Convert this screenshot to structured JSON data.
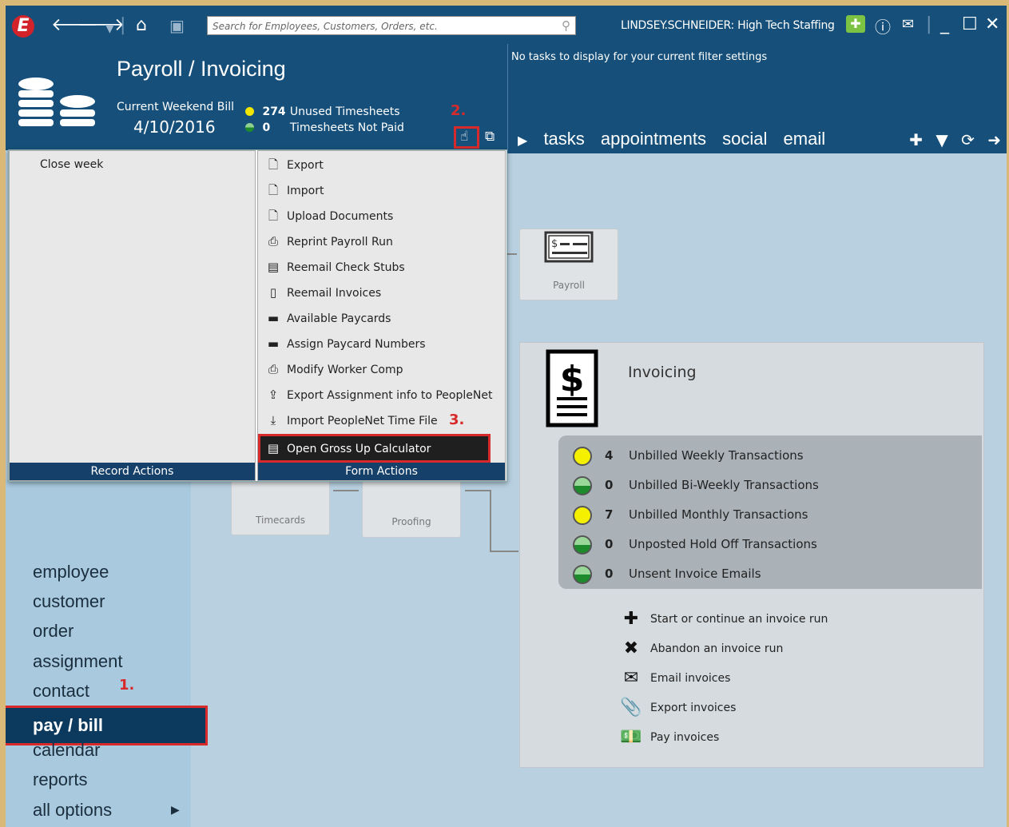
{
  "titlebar": {
    "logo_letter": "E",
    "search_placeholder": "Search for Employees, Customers, Orders, etc.",
    "user_label": "LINDSEY.SCHNEIDER: High Tech Staffing"
  },
  "header": {
    "title": "Payroll / Invoicing",
    "weekend_label": "Current Weekend Bill",
    "weekend_date": "4/10/2016",
    "stats": [
      {
        "count": "274",
        "label": "Unused Timesheets",
        "color": "#f2e600"
      },
      {
        "count": "0",
        "label": "Timesheets Not Paid",
        "color": "#1d8a2c"
      }
    ],
    "no_tasks": "No tasks to display for your current filter settings",
    "tabs": [
      "tasks",
      "appointments",
      "social",
      "email"
    ]
  },
  "popup": {
    "record_actions": {
      "items": [
        "Close week"
      ],
      "footer": "Record Actions"
    },
    "form_actions": {
      "items": [
        {
          "label": "Export",
          "icon": "document-icon"
        },
        {
          "label": "Import",
          "icon": "document-icon"
        },
        {
          "label": "Upload Documents",
          "icon": "document-icon"
        },
        {
          "label": "Reprint Payroll Run",
          "icon": "printer-icon"
        },
        {
          "label": "Reemail Check Stubs",
          "icon": "check-stub-icon"
        },
        {
          "label": "Reemail Invoices",
          "icon": "invoice-icon"
        },
        {
          "label": "Available Paycards",
          "icon": "card-icon"
        },
        {
          "label": "Assign Paycard Numbers",
          "icon": "card-icon"
        },
        {
          "label": "Modify Worker Comp",
          "icon": "printer-icon"
        },
        {
          "label": "Export Assignment info to PeopleNet",
          "icon": "upload-icon"
        },
        {
          "label": "Import PeopleNet Time File",
          "icon": "download-icon"
        },
        {
          "label": "Open Gross Up Calculator",
          "icon": "calculator-icon"
        }
      ],
      "footer": "Form Actions"
    }
  },
  "annotations": {
    "a1": "1.",
    "a2": "2.",
    "a3": "3."
  },
  "nav": {
    "items": [
      "employee",
      "customer",
      "order",
      "assignment",
      "contact",
      "pay / bill",
      "calendar",
      "reports",
      "all options"
    ],
    "active": "pay / bill"
  },
  "workflow": {
    "payroll": "Payroll",
    "timecards": "Timecards",
    "proofing": "Proofing"
  },
  "invoicing": {
    "title": "Invoicing",
    "rows": [
      {
        "count": "4",
        "label": "Unbilled Weekly Transactions",
        "status": "yellow"
      },
      {
        "count": "0",
        "label": "Unbilled Bi-Weekly Transactions",
        "status": "green"
      },
      {
        "count": "7",
        "label": "Unbilled Monthly Transactions",
        "status": "yellow"
      },
      {
        "count": "0",
        "label": "Unposted Hold Off Transactions",
        "status": "green"
      },
      {
        "count": "0",
        "label": "Unsent Invoice Emails",
        "status": "green"
      }
    ],
    "actions": [
      {
        "label": "Start or continue an invoice run",
        "icon": "plus-icon"
      },
      {
        "label": "Abandon an invoice run",
        "icon": "x-icon"
      },
      {
        "label": "Email invoices",
        "icon": "envelope-icon"
      },
      {
        "label": "Export invoices",
        "icon": "paperclip-icon"
      },
      {
        "label": "Pay invoices",
        "icon": "money-icon"
      }
    ]
  }
}
